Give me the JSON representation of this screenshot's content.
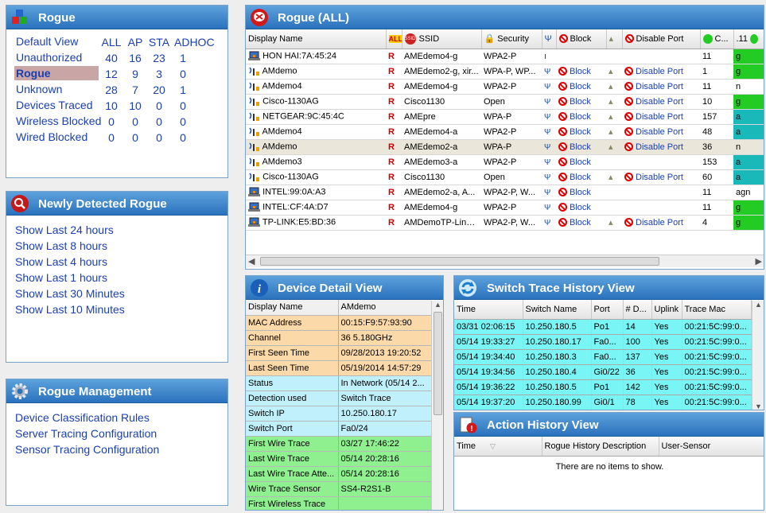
{
  "rogue_summary": {
    "title": "Rogue",
    "headers": [
      "ALL",
      "AP",
      "STA",
      "ADHOC"
    ],
    "rows": [
      {
        "label": "Default View",
        "vals": [
          "",
          "",
          "",
          ""
        ]
      },
      {
        "label": "Unauthorized",
        "vals": [
          "40",
          "16",
          "23",
          "1"
        ]
      },
      {
        "label": "Rogue",
        "vals": [
          "12",
          "9",
          "3",
          "0"
        ]
      },
      {
        "label": "Unknown",
        "vals": [
          "28",
          "7",
          "20",
          "1"
        ]
      },
      {
        "label": "Devices Traced",
        "vals": [
          "10",
          "10",
          "0",
          "0"
        ]
      },
      {
        "label": "Wireless Blocked",
        "vals": [
          "0",
          "0",
          "0",
          "0"
        ]
      },
      {
        "label": "Wired Blocked",
        "vals": [
          "0",
          "0",
          "0",
          "0"
        ]
      }
    ]
  },
  "newly": {
    "title": "Newly Detected Rogue",
    "links": [
      "Show Last 24 hours",
      "Show Last 8 hours",
      "Show Last 4 hours",
      "Show Last 1 hours",
      "Show Last 30 Minutes",
      "Show Last 10 Minutes"
    ]
  },
  "mgmt": {
    "title": "Rogue Management",
    "links": [
      "Device Classification Rules",
      "Server Tracing Configuration",
      "Sensor Tracing Configuration"
    ]
  },
  "rogue_all": {
    "title": "Rogue (ALL)",
    "columns": {
      "display": "Display Name",
      "all": "ALL",
      "ssid_icon": "SSID",
      "ssid": "SSID",
      "security": "Security",
      "block": "Block",
      "disable": "Disable Port",
      "c": "C...",
      "band": ".11"
    },
    "rows": [
      {
        "name": "HON HAI:7A:45:24",
        "r": "R",
        "ssid": "AMEdemo4-g",
        "sec": "WPA2-P",
        "block": "",
        "disable": "",
        "c": "11",
        "band": "g"
      },
      {
        "name": "AMdemo",
        "r": "R",
        "ssid": "AMEdemo2-g, xir...",
        "sec": "WPA-P, WP...",
        "block": "Block",
        "disable": "Disable Port",
        "c": "1",
        "band": "g"
      },
      {
        "name": "AMdemo4",
        "r": "R",
        "ssid": "AMEdemo4-g",
        "sec": "WPA2-P",
        "block": "Block",
        "disable": "Disable Port",
        "c": "11",
        "band": "n"
      },
      {
        "name": "Cisco-1130AG",
        "r": "R",
        "ssid": "Cisco1130",
        "sec": "Open",
        "block": "Block",
        "disable": "Disable Port",
        "c": "10",
        "band": "g"
      },
      {
        "name": "NETGEAR:9C:45:4C",
        "r": "R",
        "ssid": "AMEpre",
        "sec": "WPA-P",
        "block": "Block",
        "disable": "Disable Port",
        "c": "157",
        "band": "a"
      },
      {
        "name": "AMdemo4",
        "r": "R",
        "ssid": "AMEdemo4-a",
        "sec": "WPA2-P",
        "block": "Block",
        "disable": "Disable Port",
        "c": "48",
        "band": "a"
      },
      {
        "name": "AMdemo",
        "r": "R",
        "ssid": "AMEdemo2-a",
        "sec": "WPA-P",
        "block": "Block",
        "disable": "Disable Port",
        "c": "36",
        "band": "n"
      },
      {
        "name": "AMdemo3",
        "r": "R",
        "ssid": "AMEdemo3-a",
        "sec": "WPA2-P",
        "block": "Block",
        "disable": "",
        "c": "153",
        "band": "a"
      },
      {
        "name": "Cisco-1130AG",
        "r": "R",
        "ssid": "Cisco1130",
        "sec": "Open",
        "block": "Block",
        "disable": "Disable Port",
        "c": "60",
        "band": "a"
      },
      {
        "name": "INTEL:99:0A:A3",
        "r": "R",
        "ssid": "AMEdemo2-a, A...",
        "sec": "WPA2-P, W...",
        "block": "Block",
        "disable": "",
        "c": "11",
        "band": "agn"
      },
      {
        "name": "INTEL:CF:4A:D7",
        "r": "R",
        "ssid": "AMEdemo4-g",
        "sec": "WPA2-P",
        "block": "Block",
        "disable": "",
        "c": "11",
        "band": "g"
      },
      {
        "name": "TP-LINK:E5:BD:36",
        "r": "R",
        "ssid": "AMDemoTP-Link, ...",
        "sec": "WPA2-P, W...",
        "block": "Block",
        "disable": "Disable Port",
        "c": "4",
        "band": "g"
      }
    ]
  },
  "device_detail": {
    "title": "Device Detail View",
    "head": [
      "Display Name",
      "AMdemo"
    ],
    "rows": [
      {
        "k": "MAC Address",
        "v": "00:15:F9:57:93:90",
        "cls": "orange"
      },
      {
        "k": "Channel",
        "v": "36 5.180GHz",
        "cls": "orange"
      },
      {
        "k": "First Seen Time",
        "v": "09/28/2013 19:20:52",
        "cls": "orange"
      },
      {
        "k": "Last Seen Time",
        "v": "05/19/2014 14:57:29",
        "cls": "orange"
      },
      {
        "k": "Status",
        "v": "In Network (05/14 2...",
        "cls": "blue"
      },
      {
        "k": "Detection used",
        "v": "Switch Trace",
        "cls": "blue"
      },
      {
        "k": "Switch IP",
        "v": "10.250.180.17",
        "cls": "blue"
      },
      {
        "k": "Switch Port",
        "v": "Fa0/24",
        "cls": "blue"
      },
      {
        "k": "First Wire Trace",
        "v": "03/27 17:46:22",
        "cls": "green"
      },
      {
        "k": "Last Wire Trace",
        "v": "05/14 20:28:16",
        "cls": "green"
      },
      {
        "k": "Last Wire Trace Atte...",
        "v": "05/14 20:28:16",
        "cls": "green"
      },
      {
        "k": "Wire Trace Sensor",
        "v": "SS4-R2S1-B",
        "cls": "green"
      },
      {
        "k": "First Wireless Trace",
        "v": "",
        "cls": "green"
      }
    ]
  },
  "switch_trace": {
    "title": "Switch Trace History View",
    "columns": [
      "Time",
      "Switch Name",
      "Port",
      "# D...",
      "Uplink",
      "Trace Mac"
    ],
    "rows": [
      [
        "03/31 02:06:15",
        "10.250.180.5",
        "Po1",
        "14",
        "Yes",
        "00:21:5C:99:0..."
      ],
      [
        "05/14 19:33:27",
        "10.250.180.17",
        "Fa0...",
        "100",
        "Yes",
        "00:21:5C:99:0..."
      ],
      [
        "05/14 19:34:40",
        "10.250.180.3",
        "Fa0...",
        "137",
        "Yes",
        "00:21:5C:99:0..."
      ],
      [
        "05/14 19:34:56",
        "10.250.180.4",
        "Gi0/22",
        "36",
        "Yes",
        "00:21:5C:99:0..."
      ],
      [
        "05/14 19:36:22",
        "10.250.180.5",
        "Po1",
        "142",
        "Yes",
        "00:21:5C:99:0..."
      ],
      [
        "05/14 19:37:20",
        "10.250.180.99",
        "Gi0/1",
        "78",
        "Yes",
        "00:21:5C:99:0..."
      ]
    ]
  },
  "action_history": {
    "title": "Action History View",
    "columns": [
      "Time",
      "Rogue History Description",
      "User-Sensor"
    ],
    "empty": "There are no items to show."
  }
}
